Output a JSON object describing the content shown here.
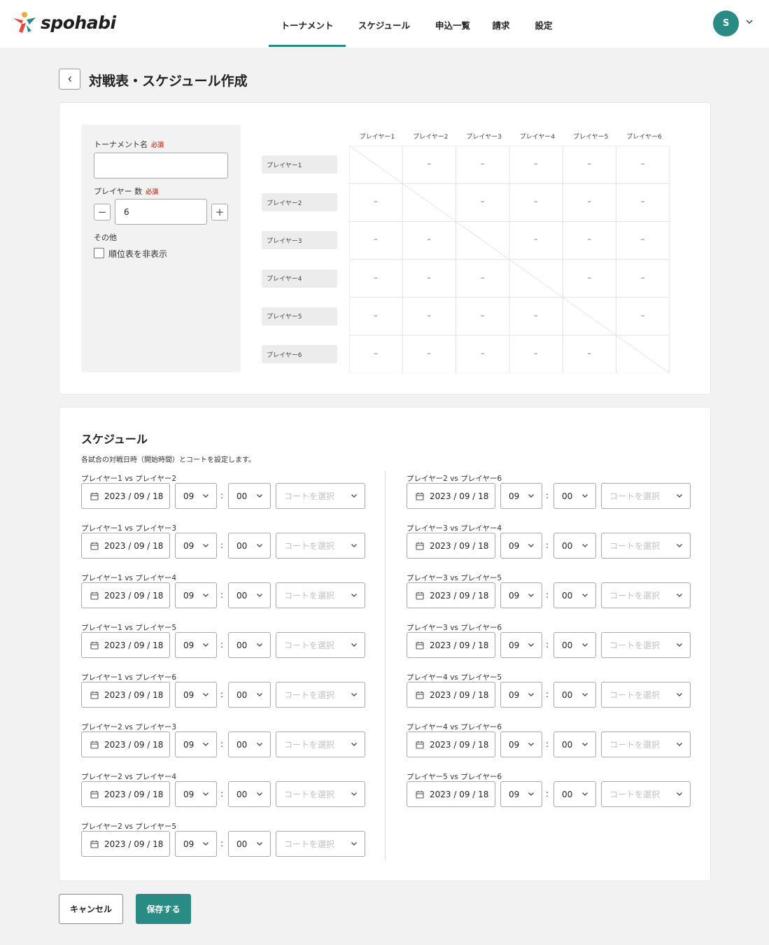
{
  "app": {
    "name": "spohabi"
  },
  "nav": {
    "items": [
      {
        "label": "トーナメント",
        "active": true
      },
      {
        "label": "スケジュール",
        "active": false
      },
      {
        "label": "申込一覧",
        "active": false
      },
      {
        "label": "請求",
        "active": false
      },
      {
        "label": "設定",
        "active": false
      }
    ]
  },
  "user": {
    "initial": "S"
  },
  "page": {
    "title": "対戦表・スケジュール作成"
  },
  "settings": {
    "tournament_name_label": "トーナメント名",
    "required_label": "必須",
    "tournament_name_value": "",
    "player_count_label": "プレイヤー 数",
    "player_count_value": "6",
    "decrement_label": "−",
    "increment_label": "+",
    "other_label": "その他",
    "hide_ranking_label": "順位表を非表示",
    "hide_ranking_checked": false
  },
  "matrix": {
    "players": [
      "プレイヤー1",
      "プレイヤー2",
      "プレイヤー3",
      "プレイヤー4",
      "プレイヤー5",
      "プレイヤー6"
    ],
    "empty_cell": "–"
  },
  "schedule": {
    "title": "スケジュール",
    "description": "各試合の対戦日時（開始時間）とコートを設定します。",
    "court_placeholder": "コートを選択",
    "time_separator": ":",
    "matches": [
      {
        "label": "プレイヤー1 vs プレイヤー2",
        "date": "2023 / 09 / 18",
        "hour": "09",
        "minute": "00"
      },
      {
        "label": "プレイヤー1 vs プレイヤー3",
        "date": "2023 / 09 / 18",
        "hour": "09",
        "minute": "00"
      },
      {
        "label": "プレイヤー1 vs プレイヤー4",
        "date": "2023 / 09 / 18",
        "hour": "09",
        "minute": "00"
      },
      {
        "label": "プレイヤー1 vs プレイヤー5",
        "date": "2023 / 09 / 18",
        "hour": "09",
        "minute": "00"
      },
      {
        "label": "プレイヤー1 vs プレイヤー6",
        "date": "2023 / 09 / 18",
        "hour": "09",
        "minute": "00"
      },
      {
        "label": "プレイヤー2 vs プレイヤー3",
        "date": "2023 / 09 / 18",
        "hour": "09",
        "minute": "00"
      },
      {
        "label": "プレイヤー2 vs プレイヤー4",
        "date": "2023 / 09 / 18",
        "hour": "09",
        "minute": "00"
      },
      {
        "label": "プレイヤー2 vs プレイヤー5",
        "date": "2023 / 09 / 18",
        "hour": "09",
        "minute": "00"
      },
      {
        "label": "プレイヤー2 vs プレイヤー6",
        "date": "2023 / 09 / 18",
        "hour": "09",
        "minute": "00"
      },
      {
        "label": "プレイヤー3 vs プレイヤー4",
        "date": "2023 / 09 / 18",
        "hour": "09",
        "minute": "00"
      },
      {
        "label": "プレイヤー3 vs プレイヤー5",
        "date": "2023 / 09 / 18",
        "hour": "09",
        "minute": "00"
      },
      {
        "label": "プレイヤー3 vs プレイヤー6",
        "date": "2023 / 09 / 18",
        "hour": "09",
        "minute": "00"
      },
      {
        "label": "プレイヤー4 vs プレイヤー5",
        "date": "2023 / 09 / 18",
        "hour": "09",
        "minute": "00"
      },
      {
        "label": "プレイヤー4 vs プレイヤー6",
        "date": "2023 / 09 / 18",
        "hour": "09",
        "minute": "00"
      },
      {
        "label": "プレイヤー5 vs プレイヤー6",
        "date": "2023 / 09 / 18",
        "hour": "09",
        "minute": "00"
      }
    ]
  },
  "actions": {
    "cancel_label": "キャンセル",
    "save_label": "保存する"
  },
  "colors": {
    "accent": "#2a8a84",
    "required": "#d84a3a",
    "background": "#f2f2f2"
  }
}
